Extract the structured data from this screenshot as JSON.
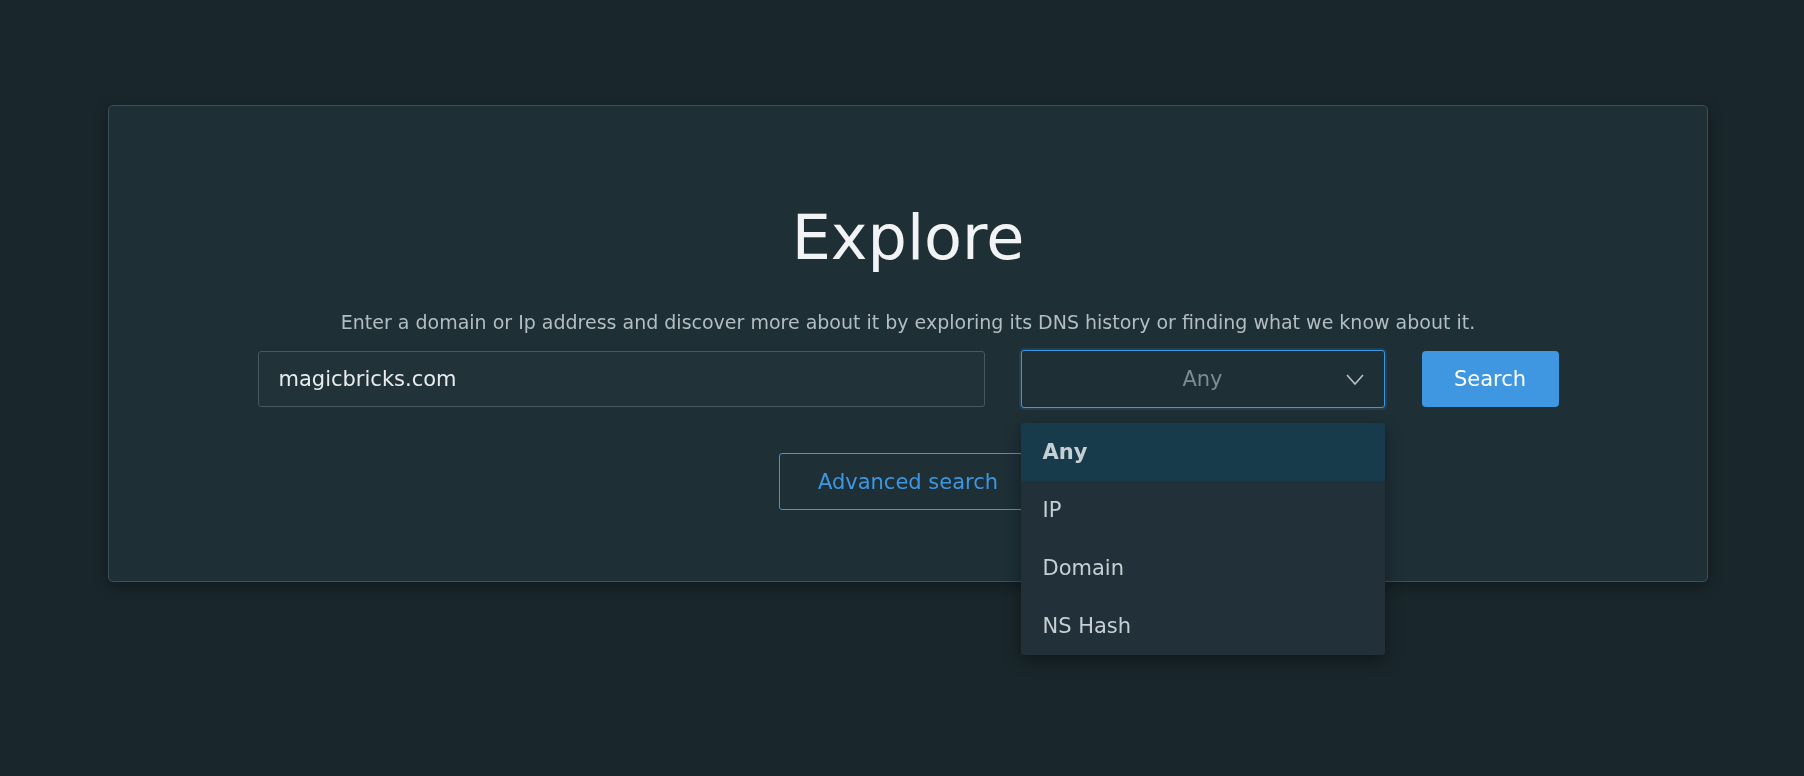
{
  "title": "Explore",
  "description": "Enter a domain or Ip address and discover more about it by exploring its DNS history or finding what we know about it.",
  "search_field": {
    "value": "magicbricks.com"
  },
  "type_select": {
    "value": "Any",
    "expanded": true,
    "options": [
      {
        "label": "Any",
        "selected": true
      },
      {
        "label": "IP",
        "selected": false
      },
      {
        "label": "Domain",
        "selected": false
      },
      {
        "label": "NS Hash",
        "selected": false
      }
    ]
  },
  "search_button": "Search",
  "advanced_search_button": "Advanced search"
}
